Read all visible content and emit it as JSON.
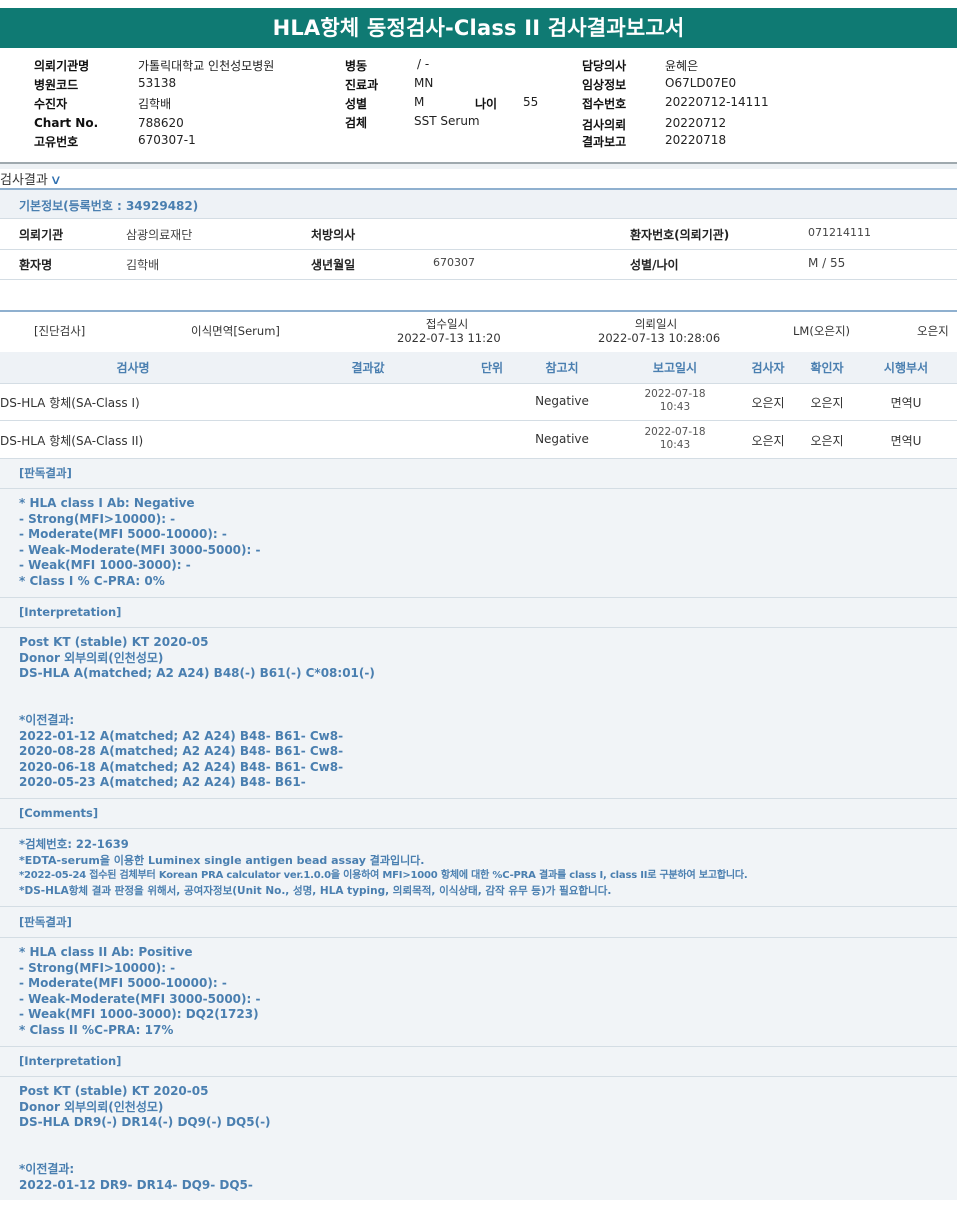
{
  "report": {
    "title": "HLA항체 동정검사-Class II 검사결과보고서"
  },
  "header": {
    "c1": [
      {
        "label": "의뢰기관명",
        "value": "가톨릭대학교 인천성모병원"
      },
      {
        "label": "병원코드",
        "value": "53138"
      },
      {
        "label": "수진자",
        "value": "김학배"
      },
      {
        "label": "Chart No.",
        "value": "788620"
      },
      {
        "label": "고유번호",
        "value": "670307-1"
      }
    ],
    "c2": [
      {
        "label": "병동",
        "value": "/ -"
      },
      {
        "label": "진료과",
        "value": "MN"
      },
      {
        "label": "성별",
        "value": "M"
      },
      {
        "label": "검체",
        "value": "SST Serum"
      }
    ],
    "age": {
      "label": "나이",
      "value": "55"
    },
    "c3": [
      {
        "label": "담당의사",
        "value": "윤혜은"
      },
      {
        "label": "임상정보",
        "value": "O67LD07E0"
      },
      {
        "label": "접수번호",
        "value": "20220712-14111"
      },
      {
        "label": "검사의뢰",
        "value": "20220712"
      },
      {
        "label": "결과보고",
        "value": "20220718"
      }
    ]
  },
  "results_tab": {
    "label": "검사결과",
    "icon": "chevron-down-icon"
  },
  "basic_info": {
    "title": "기본정보(등록번호 : 34929482)",
    "row1": [
      {
        "label": "의뢰기관",
        "value": "삼광의료재단"
      },
      {
        "label": "처방의사",
        "value": ""
      },
      {
        "label": "환자번호(의뢰기관)",
        "value": "071214111"
      }
    ],
    "row2": [
      {
        "label": "환자명",
        "value": "김학배"
      },
      {
        "label": "생년월일",
        "value": "670307"
      },
      {
        "label": "성별/나이",
        "value": "M / 55"
      }
    ]
  },
  "prescription": {
    "category": "[진단검사]",
    "name": "이식면역[Serum]",
    "received_label": "접수일시",
    "received_value": "2022-07-13 11:20",
    "requested_label": "의뢰일시",
    "requested_value": "2022-07-13 10:28:06",
    "lm": "LM(오은지)",
    "person": "오은지"
  },
  "table": {
    "headers": [
      "검사명",
      "결과값",
      "단위",
      "참고치",
      "보고일시",
      "검사자",
      "확인자",
      "시행부서"
    ],
    "rows": [
      {
        "name": "DS-HLA 항체(SA-Class I)",
        "result": "",
        "unit": "",
        "ref": "Negative",
        "date": "2022-07-18",
        "time": "10:43",
        "tester": "오은지",
        "checker": "오은지",
        "dept": "면역U"
      },
      {
        "name": "DS-HLA 항체(SA-Class II)",
        "result": "",
        "unit": "",
        "ref": "Negative",
        "date": "2022-07-18",
        "time": "10:43",
        "tester": "오은지",
        "checker": "오은지",
        "dept": "면역U"
      }
    ]
  },
  "blocks": [
    {
      "title": "[판독결과]",
      "lines": [
        "* HLA class I Ab: Negative",
        "- Strong(MFI>10000): -",
        "- Moderate(MFI 5000-10000): -",
        "- Weak-Moderate(MFI 3000-5000): -",
        "- Weak(MFI 1000-3000): -",
        "* Class I % C-PRA: 0%"
      ]
    },
    {
      "title": "[Interpretation]",
      "lines": [
        "Post KT (stable) KT 2020-05",
        "Donor 외부의뢰(인천성모)",
        "DS-HLA A(matched; A2 A24) B48(-) B61(-) C*08:01(-)",
        "",
        "",
        "*이전결과:",
        "2022-01-12 A(matched; A2 A24) B48- B61- Cw8-",
        "2020-08-28 A(matched; A2 A24) B48- B61- Cw8-",
        "2020-06-18 A(matched; A2 A24) B48- B61- Cw8-",
        "2020-05-23 A(matched; A2 A24) B48- B61-"
      ]
    },
    {
      "title": "[Comments]",
      "lines": [
        "*검체번호: 22-1639",
        "*EDTA-serum을 이용한 Luminex single antigen bead assay 결과입니다.",
        "*2022-05-24 접수된 검체부터 Korean PRA calculator ver.1.0.0을 이용하여 MFI>1000 항체에 대한 %C-PRA 결과를 class I, class II로 구분하여 보고합니다.",
        "*DS-HLA항체 결과 판정을 위해서, 공여자정보(Unit No., 성명, HLA typing, 의뢰목적, 이식상태, 감작 유무 등)가 필요합니다."
      ]
    },
    {
      "title": "[판독결과]",
      "lines": [
        "* HLA class II Ab: Positive",
        "- Strong(MFI>10000): -",
        "- Moderate(MFI 5000-10000): -",
        "- Weak-Moderate(MFI 3000-5000): -",
        "- Weak(MFI 1000-3000): DQ2(1723)",
        "* Class II %C-PRA: 17%"
      ]
    },
    {
      "title": "[Interpretation]",
      "lines": [
        "Post KT (stable) KT 2020-05",
        "Donor 외부의뢰(인천성모)",
        "DS-HLA DR9(-) DR14(-) DQ9(-) DQ5(-)",
        "",
        "",
        "*이전결과:",
        "2022-01-12 DR9- DR14- DQ9- DQ5-"
      ]
    }
  ]
}
